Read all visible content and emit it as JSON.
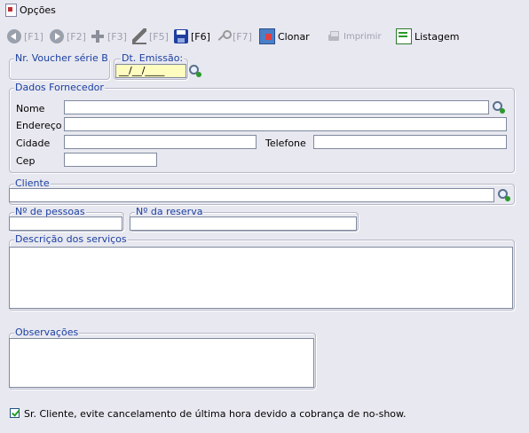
{
  "menu": {
    "label": "Opções"
  },
  "toolbar": {
    "back": "[F1]",
    "forward": "[F2]",
    "add": "[F3]",
    "edit": "[F5]",
    "save": "[F6]",
    "search": "[F7]",
    "clone": "Clonar",
    "print": "Imprimir",
    "list": "Listagem"
  },
  "voucher": {
    "legend": "Nr. Voucher série B",
    "value": ""
  },
  "emissao": {
    "legend": "Dt. Emissão:",
    "value": "__/__/____"
  },
  "fornecedor": {
    "legend": "Dados Fornecedor",
    "nome_label": "Nome",
    "endereco_label": "Endereço",
    "cidade_label": "Cidade",
    "telefone_label": "Telefone",
    "cep_label": "Cep",
    "nome": "",
    "endereco": "",
    "cidade": "",
    "telefone": "",
    "cep": ""
  },
  "cliente": {
    "legend": "Cliente",
    "value": ""
  },
  "pessoas": {
    "legend": "Nº de pessoas",
    "value": ""
  },
  "reserva": {
    "legend": "Nº da reserva",
    "value": ""
  },
  "servicos": {
    "legend": "Descrição dos serviços",
    "value": ""
  },
  "observacoes": {
    "legend": "Observações",
    "value": ""
  },
  "aviso": {
    "checked": true,
    "label": "Sr. Cliente, evite cancelamento de última hora devido a cobrança de no-show."
  }
}
